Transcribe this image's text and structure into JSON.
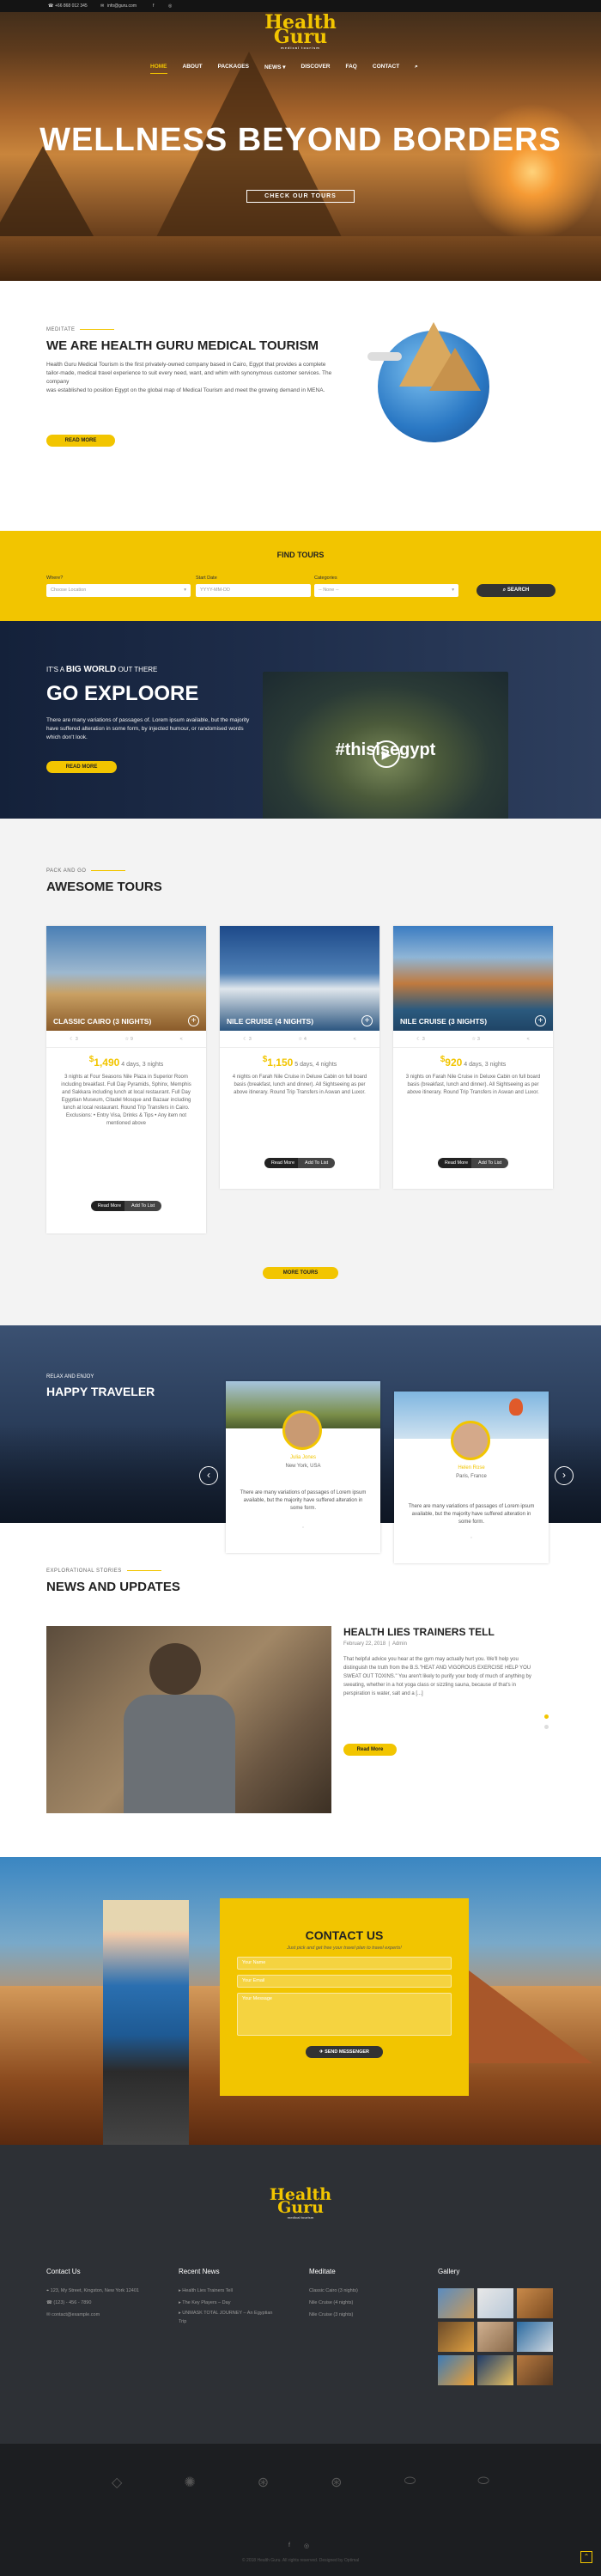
{
  "topbar": {
    "phone": "+66 868 012 345",
    "email": "info@guru.com"
  },
  "logo": {
    "line1": "Health",
    "line2": "Guru",
    "tagline": "medical tourism"
  },
  "nav": [
    "HOME",
    "ABOUT",
    "PACKAGES",
    "NEWS",
    "DISCOVER",
    "FAQ",
    "CONTACT"
  ],
  "hero": {
    "title": "WELLNESS BEYOND BORDERS",
    "button": "CHECK OUR TOURS"
  },
  "about": {
    "eyebrow": "MEDITATE",
    "title": "WE ARE HEALTH GURU MEDICAL TOURISM",
    "p1": "Health Guru Medical Tourism is the first privately-owned company based in Cairo, Egypt that provides a complete",
    "p2": "tailor-made, medical travel experience to suit every need, want, and whim with synonymous customer services. The company",
    "p3": "was established to position Egypt on the global map of Medical Tourism and meet the growing demand in MENA.",
    "button": "READ MORE"
  },
  "find": {
    "title": "FIND TOURS",
    "where_label": "Where?",
    "where_value": "Choose Location",
    "date_label": "Start Date",
    "date_value": "YYYY-MM-DD",
    "cat_label": "Categories",
    "cat_value": "-- None --",
    "search": "SEARCH"
  },
  "explore": {
    "eyebrow_pre": "IT'S A",
    "eyebrow_bold": "BIG WORLD",
    "eyebrow_post": "OUT THERE",
    "title": "GO EXPLOORE",
    "text": "There are many variations of passages of. Lorem ipsum available, but the majority have suffered alteration in some form, by injected humour, or randomised words which don't look.",
    "button": "READ MORE",
    "video_caption": "#thisisegypt"
  },
  "tours": {
    "eyebrow": "PACK AND GO",
    "title": "AWESOME TOURS",
    "more": "MORE TOURS",
    "items": [
      {
        "name": "CLASSIC CAIRO (3 NIGHTS)",
        "i1": "3",
        "i2": "9",
        "price": "1,490",
        "dur": "4 days, 3 nights",
        "desc": "3 nights at Four Seasons Nile Plaza in Superior Room including breakfast. Full Day Pyramids, Sphinx, Memphis and Sakkara including lunch at local restaurant. Full Day Egyptian Museum, Citadel Mosque and Bazaar including lunch at local restaurant. Round Trip Transfers in Cairo. Exclusions: • Entry Visa, Drinks & Tips • Any item not mentioned above",
        "read": "Read More",
        "add": "Add To List"
      },
      {
        "name": "NILE CRUISE (4 NIGHTS)",
        "i1": "3",
        "i2": "4",
        "price": "1,150",
        "dur": "5 days, 4 nights",
        "desc": "4 nights on Farah Nile Cruise in Deluxe Cabin on full board basis (breakfast, lunch and dinner). All Sightseeing as per above itinerary. Round Trip Transfers in Aswan and Luxor.",
        "read": "Read More",
        "add": "Add To List"
      },
      {
        "name": "NILE CRUISE (3 NIGHTS)",
        "i1": "3",
        "i2": "3",
        "price": "920",
        "dur": "4 days, 3 nights",
        "desc": "3 nights on Farah Nile Cruise in Deluxe Cabin on full board basis (breakfast, lunch and dinner). All Sightseeing as per above itinerary. Round Trip Transfers in Aswan and Luxor.",
        "read": "Read More",
        "add": "Add To List"
      }
    ]
  },
  "travelers": {
    "eyebrow": "RELAX AND ENJOY",
    "title": "HAPPY TRAVELER",
    "items": [
      {
        "name": "Julia Jones",
        "place": "New York, USA",
        "text": "There are many variations of passages of Lorem ipsum available, but the majority have suffered alteration in some form."
      },
      {
        "name": "Helen Rose",
        "place": "Paris, France",
        "text": "There are many variations of passages of Lorem ipsum available, but the majority have suffered alteration in some form."
      }
    ]
  },
  "news": {
    "eyebrow": "EXPLORATIONAL STORIES",
    "title": "NEWS AND UPDATES",
    "post_title": "HEALTH LIES TRAINERS TELL",
    "date": "February 22, 2018",
    "author": "Admin",
    "text": "That helpful advice you hear at the gym may actually hurt you. We'll help you distinguish the truth from the B.S.\"HEAT AND VIGOROUS EXERCISE HELP YOU SWEAT OUT TOXINS.\" You aren't likely to purify your body of much of anything by sweating, whether in a hot yoga class or sizzling sauna, because of that's in perspiration is water, salt and a [...]",
    "button": "Read More"
  },
  "contact": {
    "title": "CONTACT US",
    "subtitle": "Just pick and get free your travel plan to travel experts!",
    "name_ph": "Your Name",
    "email_ph": "Your Email",
    "msg_ph": "Your Message",
    "button": "SEND MESSENGER"
  },
  "footer": {
    "contact_title": "Contact Us",
    "address": "123, My Street, Kingston, New York 12401",
    "phone": "(123) - 456 - 7890",
    "email": "contact@example.com",
    "news_title": "Recent News",
    "news": [
      "Health Lies Trainers Tell",
      "The Key Players – Day",
      "UNMASK TOTAL JOURNEY – An Egyptian Trip"
    ],
    "meditate_title": "Meditate",
    "meditate": [
      "Classic Cairo (3 nights)",
      "Nile Cruise (4 nights)",
      "Nile Cruise (3 nights)"
    ],
    "gallery_title": "Gallery",
    "copyright": "© 2018 Health Guru. All rights reserved. Designed by Optimal"
  },
  "colors": {
    "accent": "#f2c500",
    "dark": "#2d3035",
    "navy": "#1e2d4a"
  }
}
